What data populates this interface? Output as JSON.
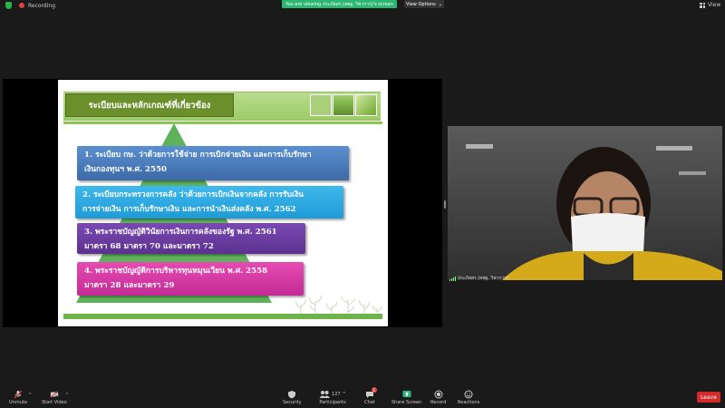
{
  "top": {
    "recording_label": "Recording",
    "banner_text": "You are viewing ประภัสสร (สพฐ. วิชาการ)'s screen",
    "view_options_label": "View Options",
    "view_label": "View"
  },
  "slide": {
    "title": "ระเบียบและหลักเกณฑ์ที่เกี่ยวข้อง",
    "items": [
      {
        "line1": "1. ระเบียบ กษ. ว่าด้วยการใช้จ่าย การเบิกจ่ายเงิน และการเก็บรักษา",
        "line2": "เงินกองทุนฯ พ.ศ. 2550"
      },
      {
        "line1": "2. ระเบียบกระทรวงการคลัง ว่าด้วยการเบิกเงินจากคลัง การรับเงิน",
        "line2": "การจ่ายเงิน การเก็บรักษาเงิน และการนำเงินส่งคลัง พ.ศ. 2562"
      },
      {
        "line1": "3. พระราชบัญญัติวินัยการเงินการคลังของรัฐ พ.ศ. 2561",
        "line2": "มาตรา 68 มาตรา 70 และมาตรา 72"
      },
      {
        "line1": "4. พระราชบัญญัติการบริหารทุนหมุนเวียน พ.ศ. 2558",
        "line2": "มาตรา 28 และมาตรา 29"
      }
    ],
    "colors": {
      "title_bg": "#6a8f2b",
      "item1": "#4a7cbc",
      "item2": "#2aa8e0",
      "item3": "#6a3ea1",
      "item4": "#d63aa5"
    }
  },
  "video": {
    "participant_name": "ประภัสสร (สพฐ. วิชาการ)"
  },
  "toolbar": {
    "unmute": "Unmute",
    "start_video": "Start Video",
    "security": "Security",
    "participants": "Participants",
    "participants_count": "127",
    "chat": "Chat",
    "chat_badge": "1",
    "share_screen": "Share Screen",
    "record": "Record",
    "reactions": "Reactions",
    "leave": "Leave"
  }
}
